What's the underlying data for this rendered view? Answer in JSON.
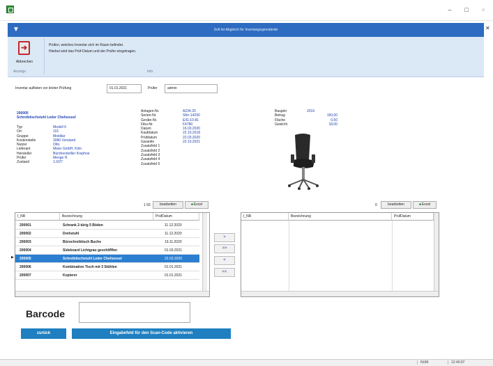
{
  "window": {
    "controls": [
      "–",
      "□",
      "×"
    ]
  },
  "ribbon": {
    "title": "Soll-Ist-Abgleich für Inventargegenstände",
    "exit_label": "Abbrechen",
    "group_left": "Anzeige",
    "group_right": "Info",
    "info_line1": "Prüfen, welches Inventar sich im Raum befindet.",
    "info_line2": "Hierbei wird das Prüf-Datum und der Prüfer eingetragen."
  },
  "filter": {
    "date_label": "Inventar auflisten vor letzter Prüfung",
    "date_value": "01.01.2021",
    "pruefer_label": "Prüfer",
    "pruefer_value": "admin"
  },
  "details": {
    "id": "200005",
    "name": "Schreibtischstuhl Leder Chefsessel",
    "left_labels": [
      "Typ",
      "Ort",
      "Gruppe",
      "Kostenstelle",
      "Nutzer",
      "Lieferant",
      "Hersteller",
      "Prüfer",
      "Zustand"
    ],
    "left_values": [
      "Modell 6",
      "101",
      "Mobiliar",
      "3080 Vorstand",
      "Otto",
      "Meier GmbH, Köln",
      "Büroherstelller Krephne",
      "Menge H.",
      "1.0/27"
    ],
    "mid_labels": [
      "Anlagen-Nr.",
      "Serien-Nr.",
      "Geräte-Nr.",
      "Fibu-Nr.",
      "Datum",
      "Kaufdatum",
      "Prüfdatum",
      "Garantie",
      "Zusatzfeld 1",
      "Zusatzfeld 2",
      "Zusatzfeld 3",
      "Zusatzfeld 4",
      "Zusatzfeld 5"
    ],
    "mid_values": [
      "A234-20",
      "Sfnr-14290",
      "E/G-10-81",
      "F4780",
      "16.03.2020",
      "22.10.2018",
      "22.03.2020",
      "22.10.2021",
      "",
      "",
      "",
      "",
      ""
    ],
    "right_labels": [
      "Baujahr",
      "Betrag",
      "Fläche",
      "Gewicht"
    ],
    "right_values": [
      "2016",
      "150,00",
      "0,50",
      "18,00"
    ]
  },
  "left_table": {
    "count": "1 55",
    "edit_label": "bearbeiten",
    "excel_label": "Excel",
    "headers": [
      "I_NR",
      "Bezeichnung",
      "PrüfDatum"
    ],
    "rows": [
      {
        "nr": "200001",
        "name": "Schrank 2-türig 5 Böden",
        "date": "11.12.2020"
      },
      {
        "nr": "200002",
        "name": "Drehstuhl",
        "date": "11.12.2020"
      },
      {
        "nr": "200003",
        "name": "Bürochreibtisch Buche",
        "date": "19.11.2020"
      },
      {
        "nr": "200004",
        "name": "Sideboard Lichtgrau geschlifffen",
        "date": "01.03.2021"
      },
      {
        "nr": "200005",
        "name": "Schreibtischstuhl Leder Chefsessel",
        "date": "22.03.2020"
      },
      {
        "nr": "200006",
        "name": "Kombination Tisch mit 3 Stühlen",
        "date": "01.01.2021"
      },
      {
        "nr": "200007",
        "name": "Kopierer",
        "date": "01.01.2021"
      }
    ]
  },
  "move_buttons": [
    ">",
    ">>",
    "<",
    "<<"
  ],
  "right_table": {
    "count": "0",
    "edit_label": "bearbeiten",
    "excel_label": "Excel",
    "headers": [
      "I_NR",
      "Bezeichnung",
      "PrüfDatum"
    ]
  },
  "barcode": {
    "label": "Barcode",
    "value": ""
  },
  "buttons": {
    "back": "zurück",
    "scan": "Eingabefeld für den Scan-Code aktivieren"
  },
  "status": {
    "left": "NUM",
    "right": "12:40:07"
  }
}
